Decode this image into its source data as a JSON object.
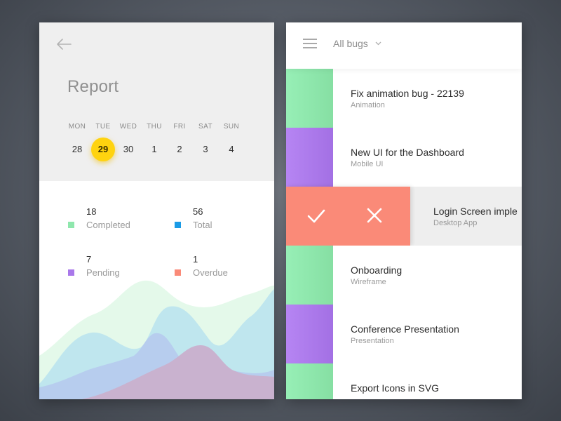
{
  "colors": {
    "green": "#8fe7ad",
    "purple": "#a978ea",
    "coral": "#fa8a78",
    "blue": "#1a9be6",
    "yellow": "#ffd30f"
  },
  "report": {
    "back_icon": "arrow-left-icon",
    "title": "Report",
    "days": [
      {
        "name": "MON",
        "num": "28"
      },
      {
        "name": "TUE",
        "num": "29",
        "selected": true
      },
      {
        "name": "WED",
        "num": "30"
      },
      {
        "name": "THU",
        "num": "1"
      },
      {
        "name": "FRI",
        "num": "2"
      },
      {
        "name": "SAT",
        "num": "3"
      },
      {
        "name": "SUN",
        "num": "4"
      }
    ],
    "stats": {
      "completed": {
        "value": "18",
        "label": "Completed",
        "color": "#8fe7ad"
      },
      "total": {
        "value": "56",
        "label": "Total",
        "color": "#1a9be6"
      },
      "pending": {
        "value": "7",
        "label": "Pending",
        "color": "#a978ea"
      },
      "overdue": {
        "value": "1",
        "label": "Overdue",
        "color": "#fa8a78"
      }
    }
  },
  "bugs": {
    "menu_icon": "hamburger-menu-icon",
    "filter_label": "All bugs",
    "filter_icon": "chevron-down-icon",
    "items": [
      {
        "title": "Fix animation bug - 22139",
        "subtitle": "Animation",
        "color": "#8fe7ad"
      },
      {
        "title": "New UI for the Dashboard",
        "subtitle": "Mobile UI",
        "color": "#a978ea"
      },
      {
        "title": "Login Screen imple",
        "subtitle": "Desktop App",
        "color": "#fa8a78",
        "swiped": true,
        "actions": [
          "check-icon",
          "close-icon"
        ]
      },
      {
        "title": "Onboarding",
        "subtitle": "Wireframe",
        "color": "#8fe7ad"
      },
      {
        "title": "Conference Presentation",
        "subtitle": "Presentation",
        "color": "#a978ea"
      },
      {
        "title": "Export Icons in SVG",
        "subtitle": "",
        "color": "#8fe7ad"
      }
    ]
  }
}
